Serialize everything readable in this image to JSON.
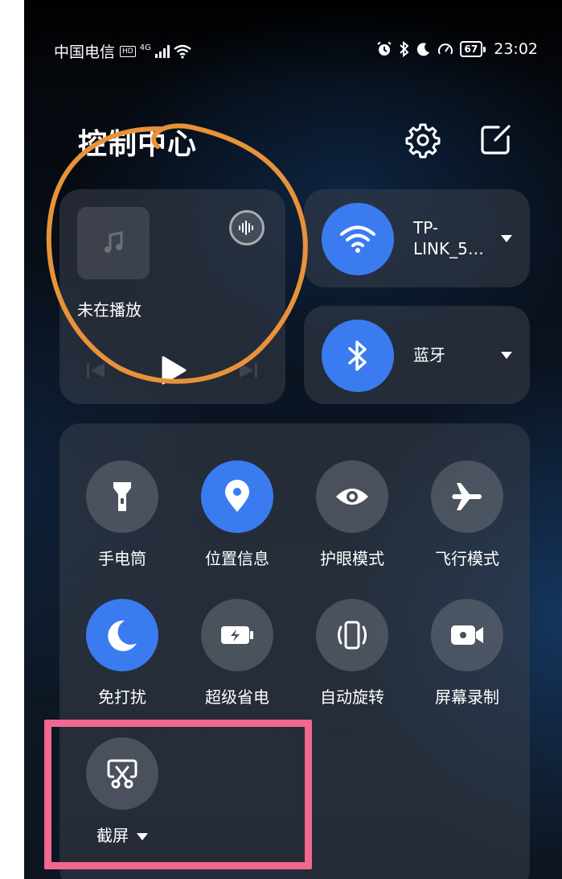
{
  "status_bar": {
    "carrier": "中国电信",
    "hd": "HD",
    "network": "4G",
    "battery": "67",
    "time": "23:02"
  },
  "header": {
    "title": "控制中心",
    "settings_icon": "gear-icon",
    "edit_icon": "edit-icon"
  },
  "media": {
    "status": "未在播放"
  },
  "wifi": {
    "label": "TP-\nLINK_5…",
    "line1": "TP-",
    "line2": "LINK_5…"
  },
  "bluetooth": {
    "label": "蓝牙"
  },
  "toggles": [
    {
      "label": "手电筒",
      "icon": "flashlight-icon",
      "on": false
    },
    {
      "label": "位置信息",
      "icon": "location-icon",
      "on": true
    },
    {
      "label": "护眼模式",
      "icon": "eye-icon",
      "on": false
    },
    {
      "label": "飞行模式",
      "icon": "airplane-icon",
      "on": false
    },
    {
      "label": "免打扰",
      "icon": "moon-icon",
      "on": true
    },
    {
      "label": "超级省电",
      "icon": "battery-saver-icon",
      "on": false
    },
    {
      "label": "自动旋转",
      "icon": "rotate-icon",
      "on": false
    },
    {
      "label": "屏幕录制",
      "icon": "screen-record-icon",
      "on": false
    },
    {
      "label": "截屏",
      "icon": "screenshot-icon",
      "on": false
    }
  ],
  "colors": {
    "accent": "#3a7bf0",
    "annotation_orange": "#e8923a",
    "annotation_pink": "#f0688f"
  }
}
